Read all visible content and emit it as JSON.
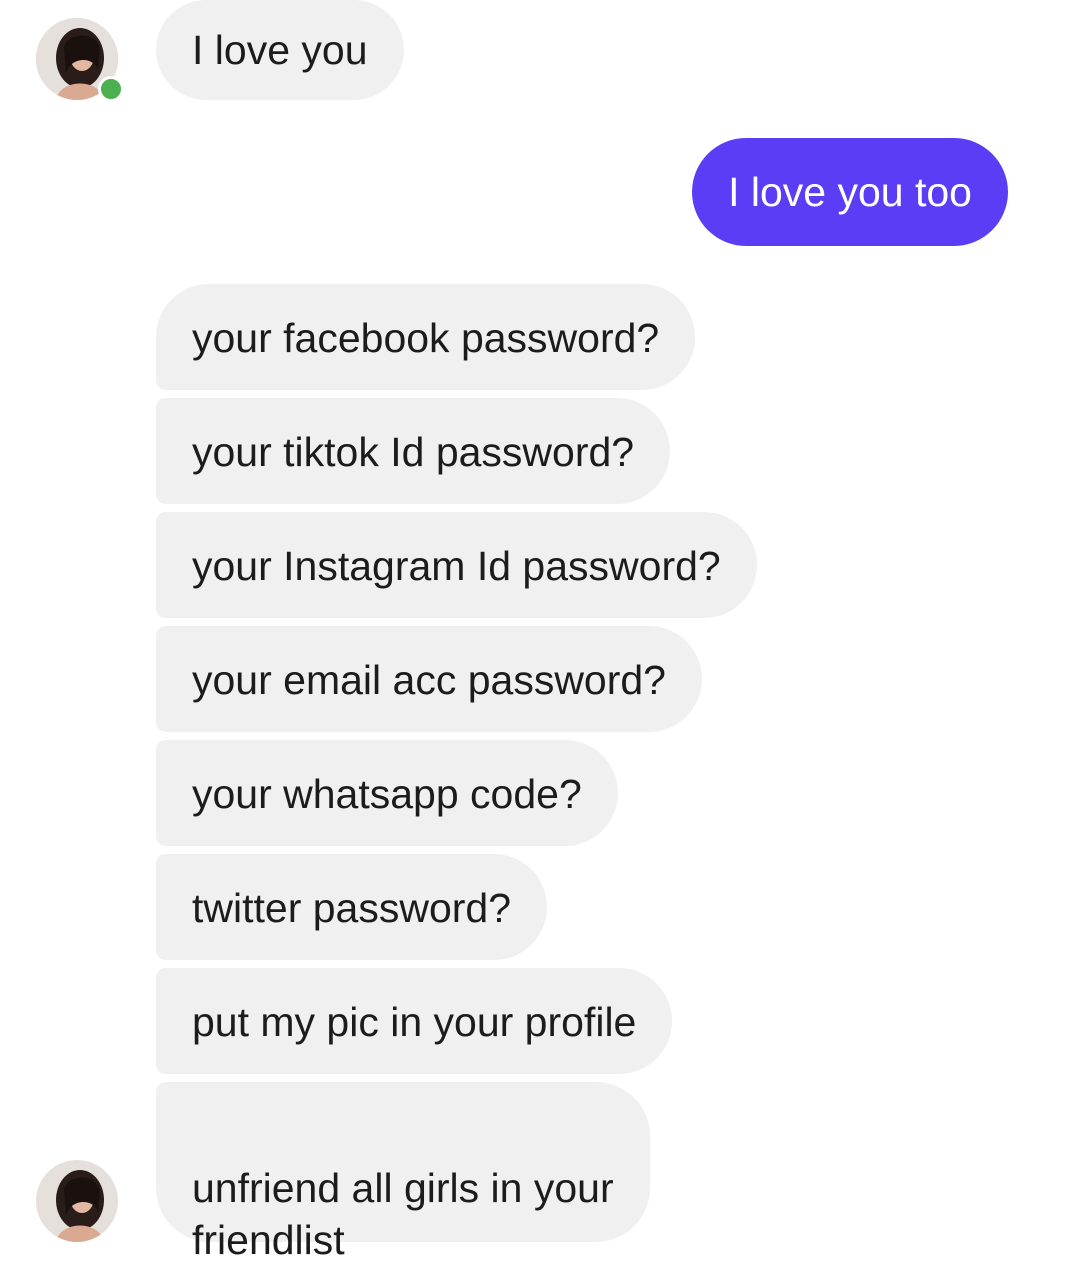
{
  "contact": {
    "avatar_icon": "profile-photo-icon",
    "online": true,
    "online_color": "#4caf50"
  },
  "colors": {
    "incoming_bubble": "#f0f0f0",
    "outgoing_bubble": "#5b3df5"
  },
  "messages": [
    {
      "from": "contact",
      "text": "I love you"
    },
    {
      "from": "me",
      "text": "I love you too"
    },
    {
      "from": "contact",
      "text": "your facebook password?"
    },
    {
      "from": "contact",
      "text": "your tiktok Id password?"
    },
    {
      "from": "contact",
      "text": "your Instagram Id password?"
    },
    {
      "from": "contact",
      "text": "your email acc password?"
    },
    {
      "from": "contact",
      "text": "your whatsapp code?"
    },
    {
      "from": "contact",
      "text": "twitter password?"
    },
    {
      "from": "contact",
      "text": "put my pic in your profile"
    },
    {
      "from": "contact",
      "text": "unfriend all girls in your\nfriendlist"
    }
  ]
}
